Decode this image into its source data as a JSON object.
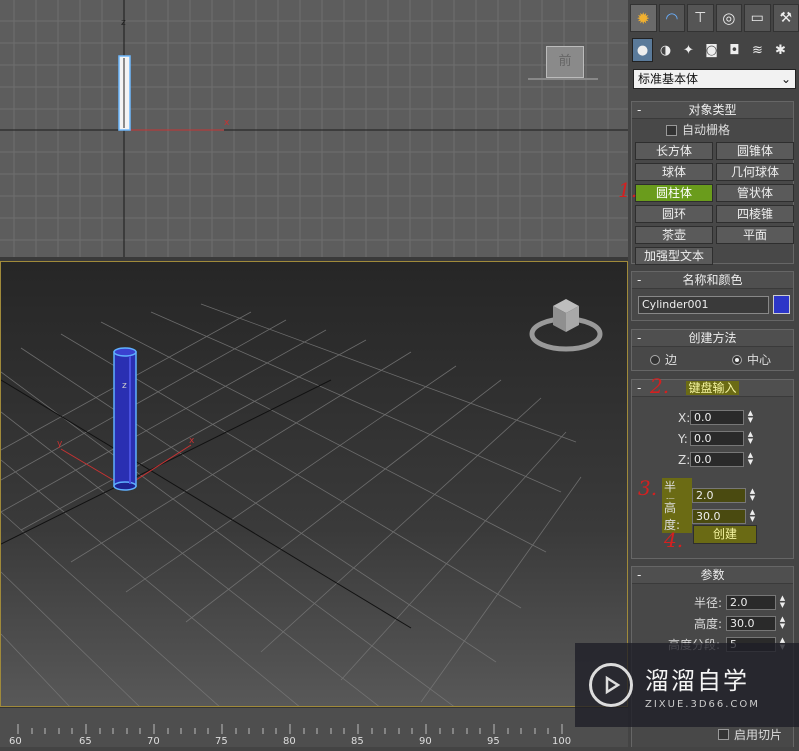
{
  "top_viewport": {
    "axis_z": "z",
    "axis_x": "x",
    "viewcube_label": "前"
  },
  "persp_viewport": {
    "axis_z": "z",
    "axis_x": "x",
    "axis_y": "y"
  },
  "timeline": {
    "ticks": [
      "60",
      "65",
      "70",
      "75",
      "80",
      "85",
      "90",
      "95",
      "100"
    ]
  },
  "command_panel": {
    "tabs": [
      "create-tab",
      "modify-tab",
      "hierarchy-tab",
      "motion-tab",
      "display-tab",
      "utilities-tab"
    ],
    "subtabs": [
      "geometry",
      "shapes",
      "lights",
      "cameras",
      "helpers",
      "spacewarps",
      "systems"
    ],
    "category_select": "标准基本体",
    "object_type": {
      "title": "对象类型",
      "autogrid": "自动栅格",
      "buttons": [
        "长方体",
        "圆锥体",
        "球体",
        "几何球体",
        "圆柱体",
        "管状体",
        "圆环",
        "四棱锥",
        "茶壶",
        "平面"
      ],
      "extended_text": "加强型文本"
    },
    "name_color": {
      "title": "名称和颜色",
      "name_value": "Cylinder001",
      "swatch_color": "#2c36c8"
    },
    "creation_method": {
      "title": "创建方法",
      "edge": "边",
      "center": "中心"
    },
    "keyboard_entry": {
      "title": "键盘输入",
      "x_label": "X:",
      "x_value": "0.0",
      "y_label": "Y:",
      "y_value": "0.0",
      "z_label": "Z:",
      "z_value": "0.0",
      "radius_label": "半径:",
      "radius_value": "2.0",
      "height_label": "高度:",
      "height_value": "30.0",
      "create_button": "创建"
    },
    "parameters": {
      "title": "参数",
      "radius_label": "半径:",
      "radius_value": "2.0",
      "height_label": "高度:",
      "height_value": "30.0",
      "height_segments_label": "高度分段:",
      "height_segments_value": "5",
      "slice_on": "启用切片"
    }
  },
  "annotations": [
    "1.",
    "2.",
    "3.",
    "4."
  ],
  "watermark": {
    "title": "溜溜自学",
    "subtitle": "ZIXUE.3D66.COM"
  }
}
